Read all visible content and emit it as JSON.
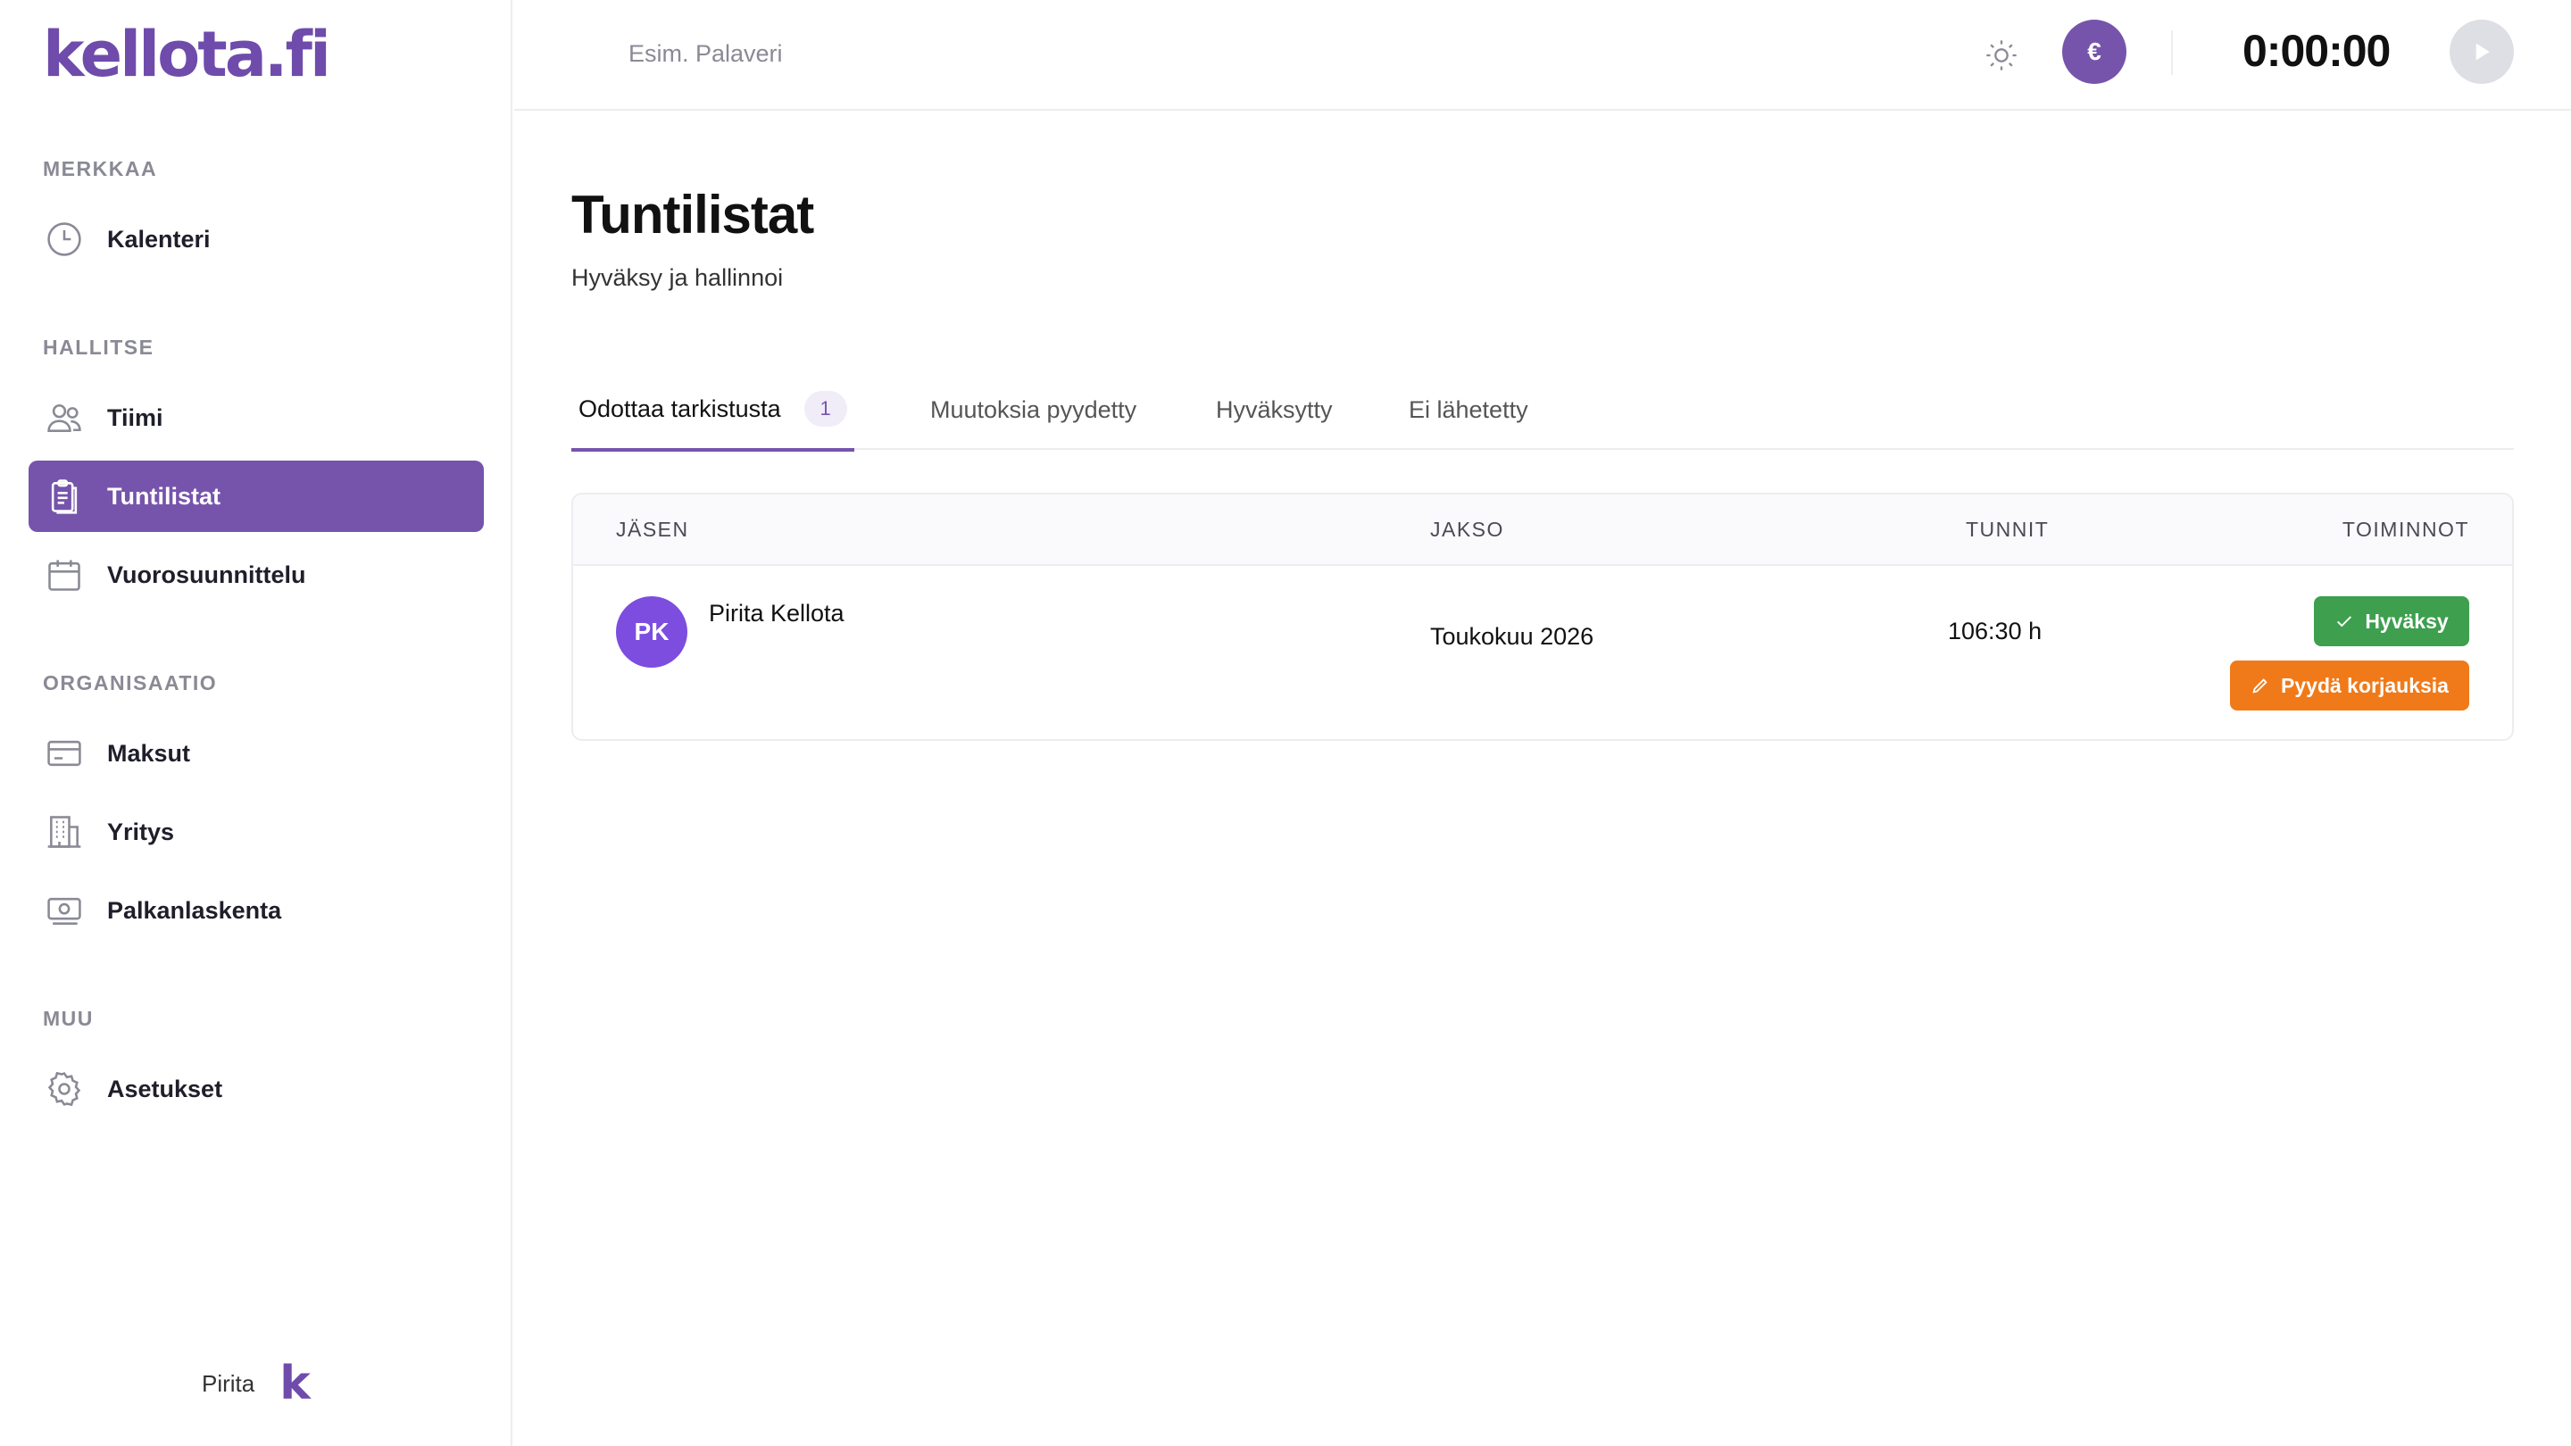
{
  "app": {
    "logo": "kellota.fi"
  },
  "sidebar": {
    "sections": [
      {
        "title": "MERKKAA"
      },
      {
        "title": "HALLITSE"
      },
      {
        "title": "ORGANISAATIO"
      },
      {
        "title": "MUU"
      }
    ],
    "items": [
      {
        "label": "Kalenteri",
        "icon": "clock-icon"
      },
      {
        "label": "Tiimi",
        "icon": "users-icon"
      },
      {
        "label": "Tuntilistat",
        "icon": "clipboard-icon",
        "active": true
      },
      {
        "label": "Vuorosuunnittelu",
        "icon": "calendar-icon"
      },
      {
        "label": "Maksut",
        "icon": "credit-card-icon"
      },
      {
        "label": "Yritys",
        "icon": "building-icon"
      },
      {
        "label": "Palkanlaskenta",
        "icon": "money-icon"
      },
      {
        "label": "Asetukset",
        "icon": "gear-icon"
      }
    ],
    "user": {
      "name": "Pirita",
      "logo_mark": "k"
    }
  },
  "header": {
    "task_placeholder": "Esim. Palaveri",
    "euro_label": "€",
    "timer": "0:00:00"
  },
  "page": {
    "title": "Tuntilistat",
    "subtitle": "Hyväksy ja hallinnoi"
  },
  "tabs": [
    {
      "label": "Odottaa tarkistusta",
      "count": "1",
      "active": true
    },
    {
      "label": "Muutoksia pyydetty"
    },
    {
      "label": "Hyväksytty"
    },
    {
      "label": "Ei lähetetty"
    }
  ],
  "table": {
    "columns": [
      "JÄSEN",
      "JAKSO",
      "TUNNIT",
      "TOIMINNOT"
    ],
    "rows": [
      {
        "initials": "PK",
        "member": "Pirita Kellota",
        "period": "Toukokuu 2026",
        "hours": "106:30 h",
        "approve_label": "Hyväksy",
        "request_fix_label": "Pyydä korjauksia"
      }
    ]
  },
  "colors": {
    "brand": "#7654ac",
    "approve": "#3e9f4e",
    "request_fix": "#f07a19",
    "avatar": "#7c4ddf"
  }
}
